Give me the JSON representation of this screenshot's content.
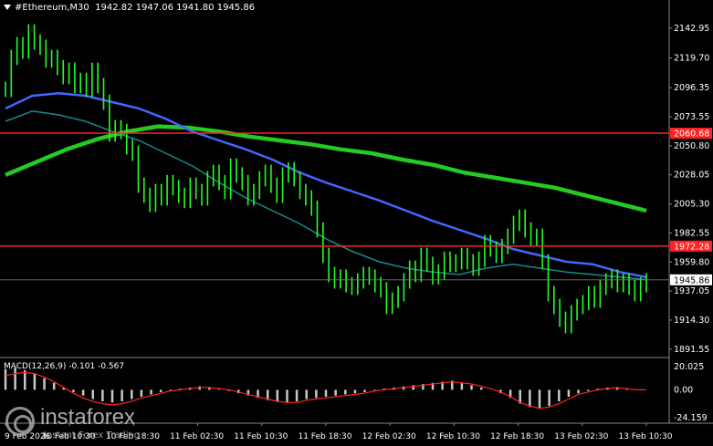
{
  "header": {
    "symbol_line": "#Ethereum,M30  1942.82 1947.06 1941.80 1945.86"
  },
  "indicator": {
    "label": "MACD(12,26,9) -0.101 -0.567"
  },
  "watermark": {
    "name": "instaforex",
    "tagline": "Instant Forex Trading"
  },
  "colors": {
    "background": "#000000",
    "candle": "#22ff22",
    "ma_fast": "#4466ff",
    "ma_slow": "#22cc22",
    "ma_mid": "#1a8a8a",
    "level": "#ff2222",
    "macd_hist": "#c8c8c8",
    "macd_signal": "#ff2222"
  },
  "price_axis": {
    "labels": [
      "2142.95",
      "2119.70",
      "2096.35",
      "2073.55",
      "2050.80",
      "2028.05",
      "2005.30",
      "1982.55",
      "1959.80",
      "1937.05",
      "1914.30",
      "1891.55"
    ],
    "min": 1885,
    "max": 2155
  },
  "levels": [
    {
      "value": 2060.68,
      "label": "2060.68"
    },
    {
      "value": 1972.28,
      "label": "1972.28"
    }
  ],
  "current_price": {
    "value": 1945.86,
    "label": "1945.86"
  },
  "macd_axis": {
    "labels": [
      "20.025",
      "0.00",
      "-24.159"
    ],
    "max": 20.025,
    "min": -24.159
  },
  "time_axis": [
    "9 Feb 2026",
    "10 Feb 10:30",
    "10 Feb 18:30",
    "11 Feb 02:30",
    "11 Feb 10:30",
    "11 Feb 18:30",
    "12 Feb 02:30",
    "12 Feb 10:30",
    "12 Feb 18:30",
    "13 Feb 02:30",
    "13 Feb 10:30"
  ],
  "chart_data": {
    "type": "candlestick",
    "title": "#Ethereum,M30",
    "close": [
      2095,
      2120,
      2130,
      2125,
      2140,
      2132,
      2128,
      2118,
      2120,
      2112,
      2105,
      2110,
      2098,
      2102,
      2095,
      2110,
      2098,
      2085,
      2060,
      2065,
      2062,
      2050,
      2045,
      2020,
      2012,
      2005,
      2015,
      2010,
      2022,
      2018,
      2012,
      2008,
      2020,
      2015,
      2010,
      2025,
      2030,
      2022,
      2015,
      2035,
      2028,
      2022,
      2010,
      2015,
      2025,
      2030,
      2020,
      2012,
      2028,
      2032,
      2025,
      2015,
      2010,
      2002,
      1985,
      1965,
      1950,
      1945,
      1948,
      1942,
      1940,
      1945,
      1950,
      1948,
      1942,
      1938,
      1925,
      1930,
      1935,
      1945,
      1955,
      1950,
      1965,
      1958,
      1948,
      1952,
      1962,
      1958,
      1960,
      1965,
      1960,
      1955,
      1962,
      1975,
      1970,
      1965,
      1972,
      1980,
      1990,
      1995,
      1985,
      1978,
      1980,
      1960,
      1935,
      1925,
      1915,
      1910,
      1920,
      1925,
      1928,
      1935,
      1930,
      1940,
      1945,
      1948,
      1942,
      1945,
      1940,
      1935,
      1942,
      1945
    ],
    "ma_fast": [
      2080,
      2090,
      2092,
      2090,
      2085,
      2080,
      2072,
      2062,
      2055,
      2048,
      2040,
      2030,
      2022,
      2015,
      2008,
      2000,
      1992,
      1985,
      1978,
      1970,
      1965,
      1960,
      1958,
      1952,
      1948
    ],
    "ma_mid": [
      2070,
      2078,
      2075,
      2070,
      2062,
      2055,
      2045,
      2035,
      2022,
      2010,
      2000,
      1990,
      1978,
      1968,
      1960,
      1955,
      1952,
      1950,
      1955,
      1958,
      1955,
      1952,
      1950,
      1948,
      1946
    ],
    "ma_slow": [
      2028,
      2038,
      2048,
      2056,
      2062,
      2066,
      2065,
      2062,
      2058,
      2055,
      2052,
      2048,
      2045,
      2040,
      2036,
      2030,
      2026,
      2022,
      2018,
      2012,
      2006,
      2000
    ],
    "macd_hist": [
      18,
      19,
      17,
      14,
      10,
      6,
      2,
      -2,
      -5,
      -8,
      -10,
      -11,
      -10,
      -8,
      -6,
      -4,
      -2,
      -1,
      1,
      2,
      3,
      2,
      1,
      -1,
      -3,
      -5,
      -7,
      -9,
      -10,
      -11,
      -10,
      -8,
      -7,
      -6,
      -5,
      -4,
      -3,
      -2,
      -1,
      1,
      2,
      3,
      4,
      5,
      6,
      7,
      8,
      6,
      4,
      2,
      0,
      -3,
      -7,
      -12,
      -15,
      -16,
      -14,
      -10,
      -6,
      -3,
      -1,
      1,
      2,
      2,
      1,
      0,
      0
    ],
    "macd_signal": [
      12,
      14,
      15,
      14,
      11,
      7,
      2,
      -3,
      -7,
      -10,
      -12,
      -13,
      -12,
      -10,
      -7,
      -5,
      -3,
      -1,
      0,
      1,
      2,
      2,
      1,
      0,
      -2,
      -4,
      -6,
      -8,
      -10,
      -11,
      -11,
      -9,
      -8,
      -7,
      -6,
      -5,
      -4,
      -3,
      -1,
      0,
      1,
      2,
      3,
      4,
      5,
      6,
      7,
      6,
      5,
      3,
      1,
      -2,
      -6,
      -11,
      -14,
      -16,
      -15,
      -12,
      -8,
      -4,
      -2,
      0,
      1,
      2,
      1,
      0,
      0
    ]
  }
}
